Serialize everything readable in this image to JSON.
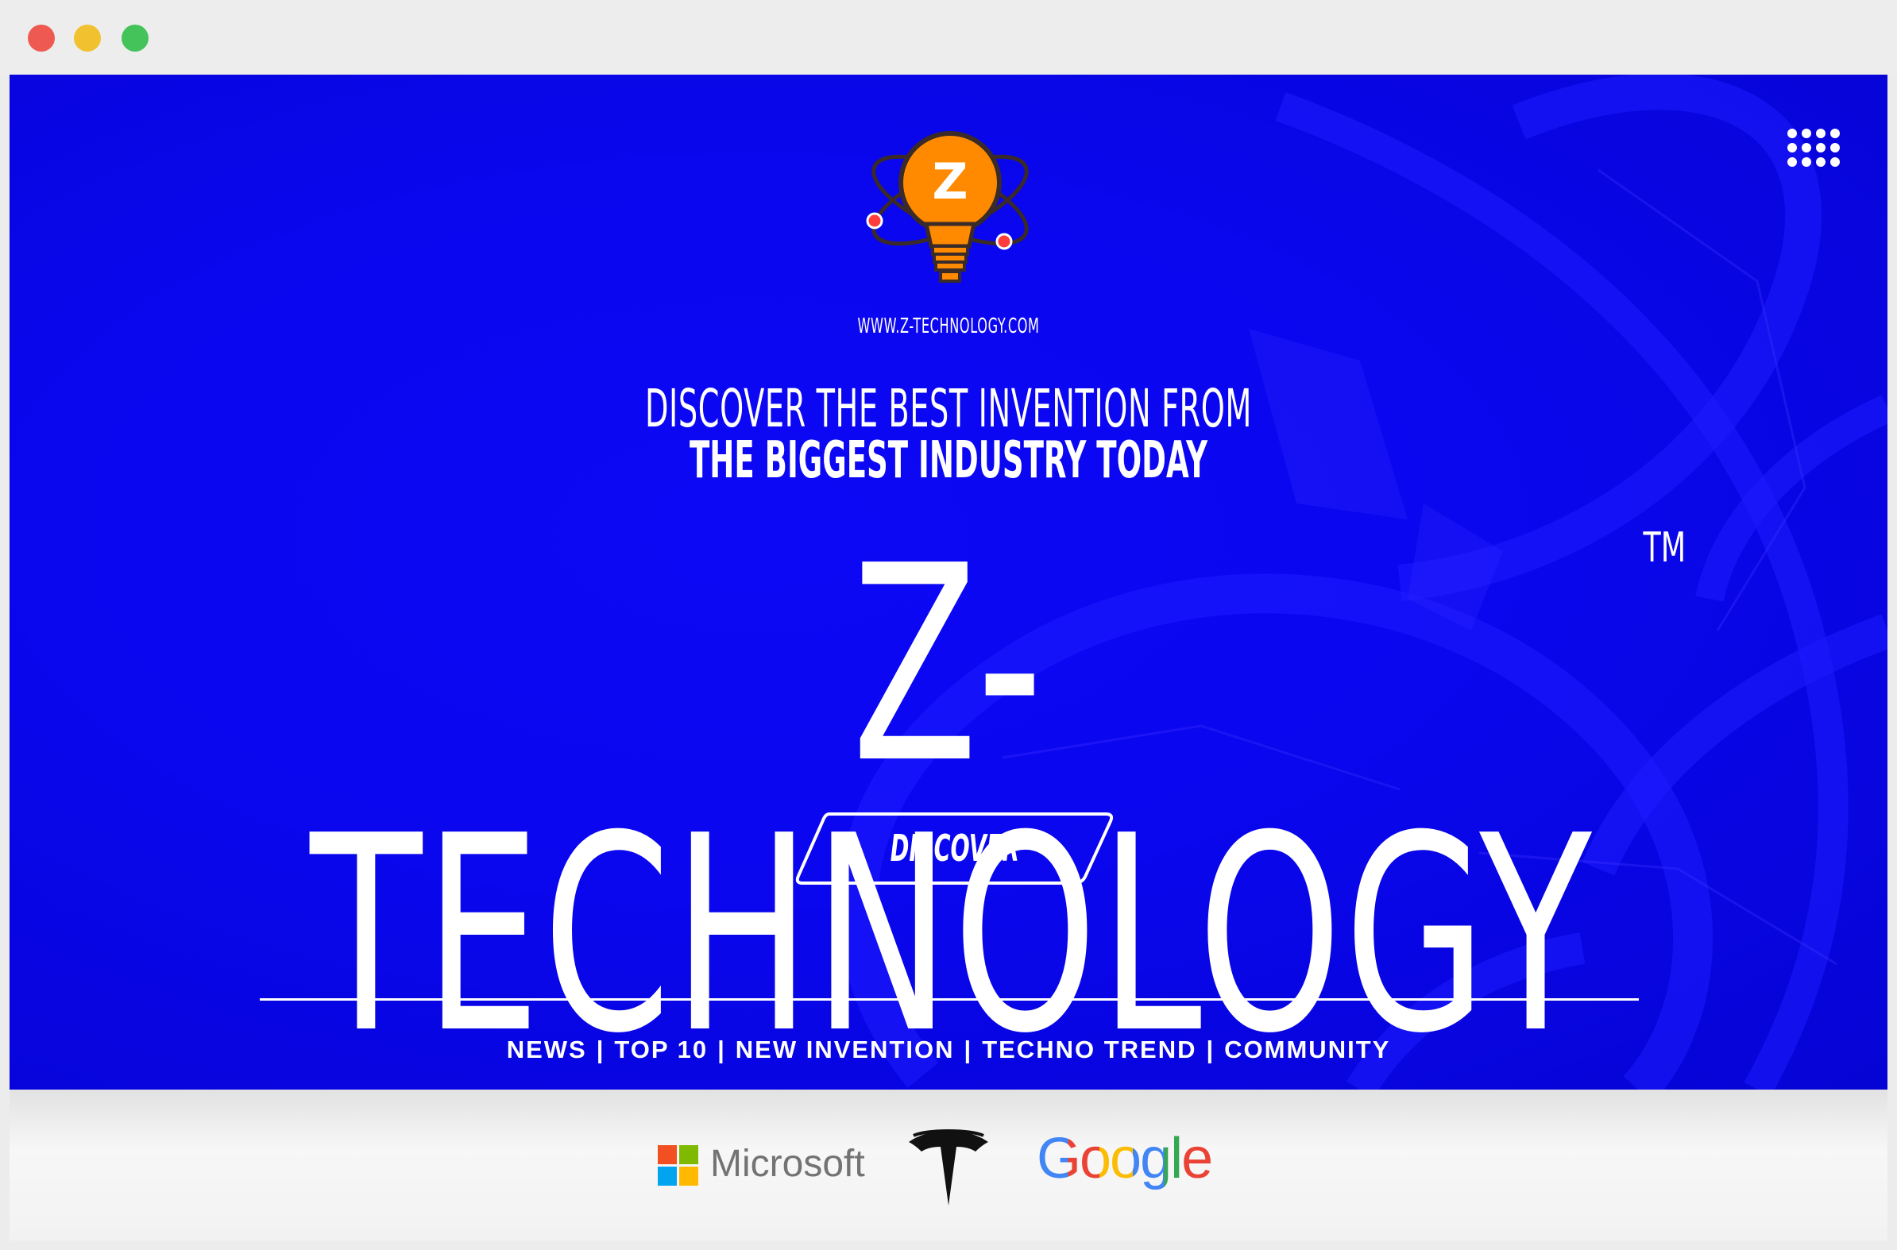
{
  "site": {
    "url": "WWW.Z-TECHNOLOGY.COM",
    "logo_letter": "Z",
    "tagline_line1": "DISCOVER THE BEST INVENTION FROM",
    "tagline_line2": "THE BIGGEST INDUSTRY TODAY",
    "brand_name": "Z-TECHNOLOGY",
    "trademark": "TM",
    "cta_label": "DISCOVER"
  },
  "nav": {
    "items": [
      "NEWS",
      "TOP 10",
      "NEW INVENTION",
      "TECHNO TREND",
      "COMMUNITY"
    ],
    "separator": "|"
  },
  "partners": {
    "microsoft": "Microsoft",
    "tesla": "Tesla logo",
    "google": "Google"
  },
  "icons": {
    "menu": "grid-menu-icon",
    "logo": "lightbulb-atom-logo"
  },
  "colors": {
    "hero_bg": "#0a06ee",
    "accent_orange": "#ff8a00",
    "text": "#ffffff",
    "partner_bar": "#f2f2f2"
  }
}
